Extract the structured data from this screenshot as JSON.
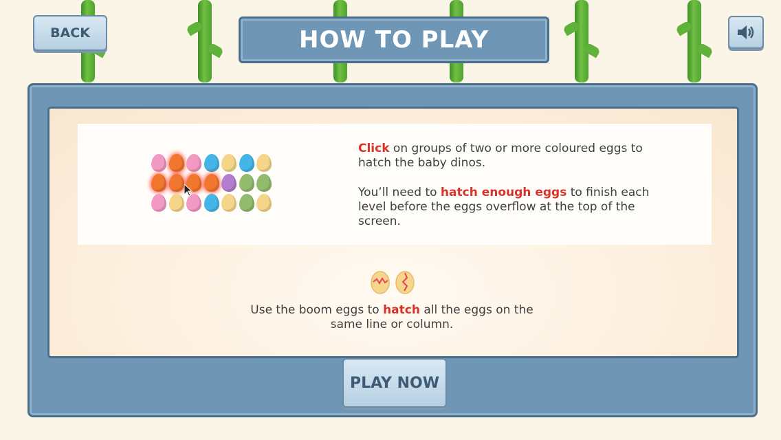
{
  "header": {
    "back_label": "BACK",
    "title": "HOW TO PLAY",
    "sound_icon": "speaker-icon"
  },
  "instructions": {
    "para1_highlight": "Click",
    "para1_rest": " on groups of two or more coloured eggs to hatch the baby dinos.",
    "para2_start": "You’ll need to ",
    "para2_highlight": "hatch enough eggs",
    "para2_end": " to finish each level before the eggs overflow at the top of the screen.",
    "para3_start": "Use the boom eggs to ",
    "para3_highlight": "hatch",
    "para3_end": " all the eggs on the same line or column."
  },
  "egg_grid": {
    "rows": [
      [
        "pink",
        "orange",
        "pink",
        "blue",
        "yellow",
        "blue",
        "yellow"
      ],
      [
        "orange",
        "orange",
        "orange",
        "orange",
        "purple",
        "green",
        "green"
      ],
      [
        "pink",
        "yellow",
        "pink",
        "blue",
        "yellow",
        "green",
        "yellow"
      ]
    ],
    "highlighted": [
      [
        0,
        1
      ],
      [
        1,
        0
      ],
      [
        1,
        1
      ],
      [
        1,
        2
      ],
      [
        1,
        3
      ]
    ],
    "colors": {
      "pink": "#f29ac4",
      "orange": "#f2772e",
      "blue": "#43b5e6",
      "yellow": "#f4d58a",
      "purple": "#b27fcf",
      "green": "#93bb6e"
    }
  },
  "footer": {
    "play_label": "PLAY NOW"
  },
  "theme": {
    "accent": "#d8322a",
    "panel": "#6f97b5",
    "text": "#3f3f3f"
  }
}
